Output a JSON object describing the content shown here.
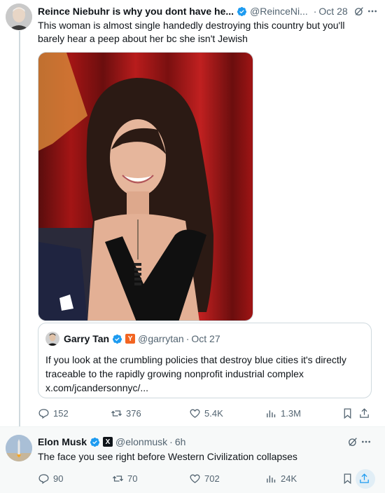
{
  "tweet1": {
    "author_name": "Reince Niebuhr is why you dont have he...",
    "handle": "@ReinceNi...",
    "date": "Oct 28",
    "text": "This woman is almost single handedly destroying this country but you'll barely hear a peep about her bc she isn't Jewish",
    "quote": {
      "author_name": "Garry Tan",
      "handle": "@garrytan",
      "date": "Oct 27",
      "badge_letter": "Y",
      "text": "If you look at the crumbling policies that destroy blue cities it's directly traceable to the rapidly growing nonprofit industrial complex",
      "link": "x.com/jcandersonnyc/..."
    },
    "stats": {
      "replies": "152",
      "reposts": "376",
      "likes": "5.4K",
      "views": "1.3M"
    }
  },
  "tweet2": {
    "author_name": "Elon Musk",
    "handle": "@elonmusk",
    "date": "6h",
    "badge_letter": "X",
    "text": "The face you see right before Western Civilization collapses",
    "stats": {
      "replies": "90",
      "reposts": "70",
      "likes": "702",
      "views": "24K"
    }
  },
  "colors": {
    "verified": "#1d9bf0",
    "secondary_text": "#536471",
    "border": "#cfd9de",
    "ycombinator": "#f26522"
  },
  "icons": [
    "verified-badge-icon",
    "grok-icon",
    "more-icon",
    "reply-icon",
    "repost-icon",
    "like-icon",
    "views-icon",
    "bookmark-icon",
    "share-icon"
  ]
}
